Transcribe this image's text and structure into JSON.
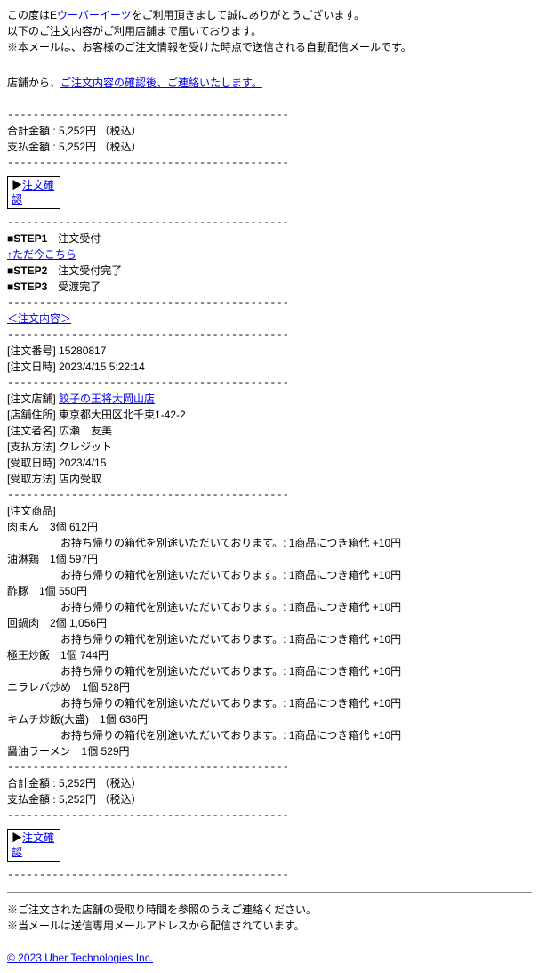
{
  "intro": {
    "line1a": "この度はE",
    "line1b": "ウーバーイーツ",
    "line1c": "をご利用頂きまして誠にありがとうございます。",
    "line2": "以下のご注文内容がご利用店舗まで届いております。",
    "line3": "※本メールは、お客様のご注文情報を受けた時点で送信される自動配信メールです。"
  },
  "contact": {
    "prefix": "店舗から、",
    "link": "ご注文内容の確認後、ご連絡いたします。"
  },
  "divider": "--------------------------------------------",
  "totals": {
    "total_label": "合計金額 : ",
    "total_value": "5,252円 （税込）",
    "pay_label": "支払金額 : ",
    "pay_value": "5,252円 （税込）"
  },
  "confirm": {
    "arrow": "▶",
    "label": "注文確認"
  },
  "steps": {
    "s1_label": "■STEP1",
    "s1_text": "注文受付",
    "here_link": "↑ただ今こちら",
    "s2_label": "■STEP2",
    "s2_text": "注文受付完了",
    "s3_label": "■STEP3",
    "s3_text": "受渡完了"
  },
  "order_header_link": "＜注文内容＞",
  "order": {
    "num_label": "[注文番号] ",
    "num_value": "15280817",
    "dt_label": "[注文日時] ",
    "dt_value": "2023/4/15 5:22:14",
    "shop_label": "[注文店舗] ",
    "shop_link": "餃子の王将大岡山店",
    "addr_label": "[店舗住所] ",
    "addr_value": "東京都大田区北千束1-42-2",
    "name_label": "[注文者名] ",
    "name_value": "広瀬　友美",
    "paym_label": "[支払方法] ",
    "paym_value": "クレジット",
    "rcvd_label": "[受取日時] ",
    "rcvd_value": "2023/4/15",
    "rcvm_label": "[受取方法] ",
    "rcvm_value": "店内受取"
  },
  "items_label": "[注文商品]",
  "box_note": "お持ち帰りの箱代を別途いただいております。: 1商品につき箱代 +10円",
  "items": [
    {
      "name": "肉まん",
      "qty": "3個",
      "price": "612円",
      "has_note": true
    },
    {
      "name": "油淋鶏",
      "qty": "1個",
      "price": "597円",
      "has_note": true
    },
    {
      "name": "酢豚",
      "qty": "1個",
      "price": "550円",
      "has_note": true
    },
    {
      "name": "回鍋肉",
      "qty": "2個",
      "price": "1,056円",
      "has_note": true
    },
    {
      "name": "極王炒飯",
      "qty": "1個",
      "price": "744円",
      "has_note": true
    },
    {
      "name": "ニラレバ炒め",
      "qty": "1個",
      "price": "528円",
      "has_note": true
    },
    {
      "name": "キムチ炒飯(大盛)",
      "qty": "1個",
      "price": "636円",
      "has_note": true
    },
    {
      "name": "醤油ラーメン",
      "qty": "1個",
      "price": "529円",
      "has_note": false
    }
  ],
  "footer": {
    "note1": "※ご注文された店舗の受取り時間を参照のうえご連絡ください。",
    "note2": "※当メールは送信専用メールアドレスから配信されています。",
    "copyright": "© 2023 Uber Technologies Inc."
  }
}
